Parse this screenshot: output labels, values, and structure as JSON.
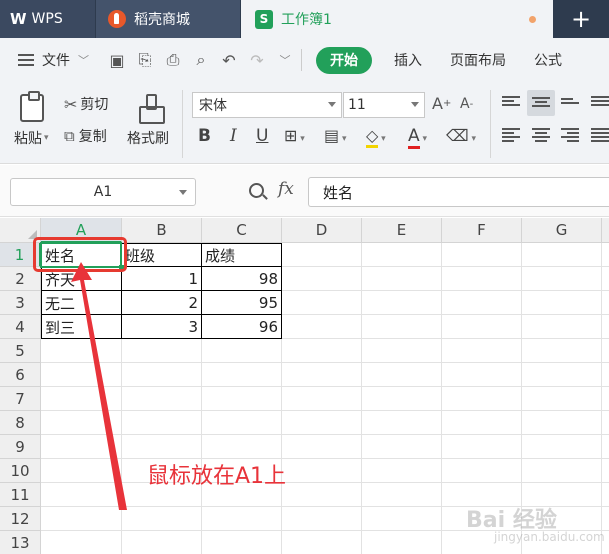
{
  "tabs": {
    "wps": "WPS",
    "daoke": "稻壳商城",
    "workbook": "工作簿1",
    "workbook_icon": "S",
    "new_tab": "+"
  },
  "menu": {
    "file": "文件",
    "tabs": [
      "开始",
      "插入",
      "页面布局",
      "公式"
    ]
  },
  "ribbon": {
    "paste": "粘贴",
    "cut": "剪切",
    "copy": "复制",
    "format_painter": "格式刷",
    "font_name": "宋体",
    "font_size": "11",
    "bold": "B",
    "italic": "I",
    "underline": "U",
    "font_color": "A"
  },
  "formula_bar": {
    "name_box": "A1",
    "fx": "fx",
    "content": "姓名"
  },
  "grid": {
    "columns": [
      "A",
      "B",
      "C",
      "D",
      "E",
      "F",
      "G"
    ],
    "rows": [
      "1",
      "2",
      "3",
      "4",
      "5",
      "6",
      "7",
      "8",
      "9",
      "10",
      "11",
      "12",
      "13"
    ],
    "cells": {
      "header": [
        "姓名",
        "班级",
        "成绩"
      ],
      "data": [
        [
          "齐天",
          "1",
          "98"
        ],
        [
          "无二",
          "2",
          "95"
        ],
        [
          "到三",
          "3",
          "96"
        ]
      ]
    },
    "selected_cell": "A1"
  },
  "annotation": "鼠标放在A1上",
  "watermark": {
    "main": "Bai 经验",
    "sub": "jingyan.baidu.com"
  },
  "colors": {
    "accent": "#22a05a",
    "annotation": "#e8333a",
    "tabbar": "#2e3b4e"
  }
}
